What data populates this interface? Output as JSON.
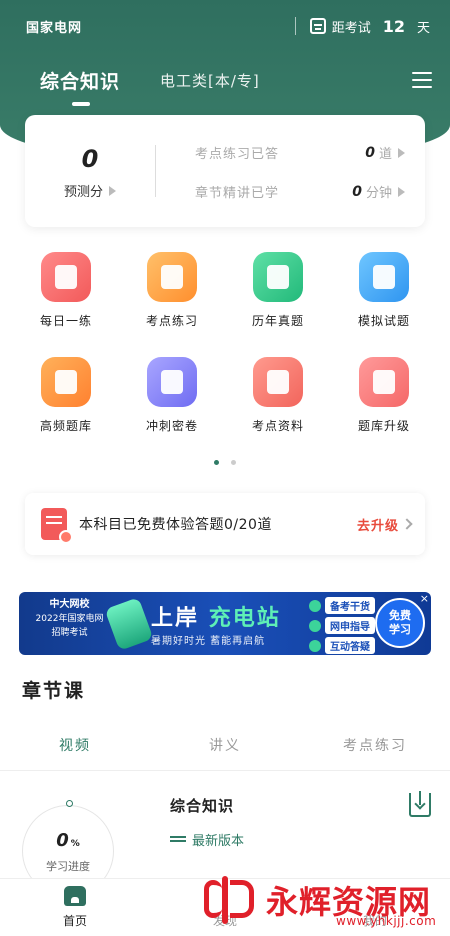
{
  "status_bar": {
    "app_name": "国家电网",
    "countdown_label": "距考试",
    "countdown_days": "12",
    "countdown_unit": "天"
  },
  "top_nav": {
    "active_tab": "综合知识",
    "category_tab": "电工类[本/专]"
  },
  "score_card": {
    "score": "0",
    "score_label": "预测分",
    "practice_label": "考点练习已答",
    "practice_value": "0",
    "practice_unit": "道",
    "chapter_label": "章节精讲已学",
    "chapter_value": "0",
    "chapter_unit": "分钟"
  },
  "grid": {
    "row1": [
      {
        "label": "每日一练",
        "icon": "calendar-check-icon",
        "color": "#f25a5a"
      },
      {
        "label": "考点练习",
        "icon": "lightning-doc-icon",
        "color": "#ff8f2e"
      },
      {
        "label": "历年真题",
        "icon": "document-icon",
        "color": "#22b97a"
      },
      {
        "label": "模拟试题",
        "icon": "monitor-chart-icon",
        "color": "#2f95f0"
      }
    ],
    "row2": [
      {
        "label": "高频题库",
        "icon": "pulse-book-icon",
        "color": "#ff8130"
      },
      {
        "label": "冲刺密卷",
        "icon": "bookmark-book-icon",
        "color": "#6f6cf2"
      },
      {
        "label": "考点资料",
        "icon": "folder-icon",
        "color": "#f2655c"
      },
      {
        "label": "题库升级",
        "icon": "upgrade-doc-icon",
        "color": "#f56868"
      }
    ]
  },
  "pager": {
    "count": 2,
    "active": 0
  },
  "upgrade": {
    "text": "本科目已免费体验答题0/20道",
    "link": "去升级"
  },
  "banner": {
    "brand": "中大网校",
    "year_line": "2022年国家电网",
    "exam_line": "招聘考试",
    "title_a": "上岸",
    "title_b": "充电站",
    "subtitle": "暑期好时光  蓄能再启航",
    "tags": [
      "备考干货",
      "网申指导",
      "互动答疑"
    ],
    "button_line1": "免费",
    "button_line2": "学习",
    "close": "×"
  },
  "section": {
    "title": "章节课"
  },
  "course_tabs": [
    "视频",
    "讲义",
    "考点练习"
  ],
  "course": {
    "progress_value": "0",
    "progress_unit": "%",
    "progress_label": "学习进度",
    "name": "综合知识",
    "version": "最新版本"
  },
  "bottom_nav": [
    "首页",
    "发现",
    "我的"
  ],
  "watermark": {
    "text": "永辉资源网",
    "url": "www.yhkjjj.com"
  },
  "colors": {
    "primary": "#2f6f5f",
    "accent_red": "#e84b3c",
    "active_tab": "#2f7b66"
  }
}
